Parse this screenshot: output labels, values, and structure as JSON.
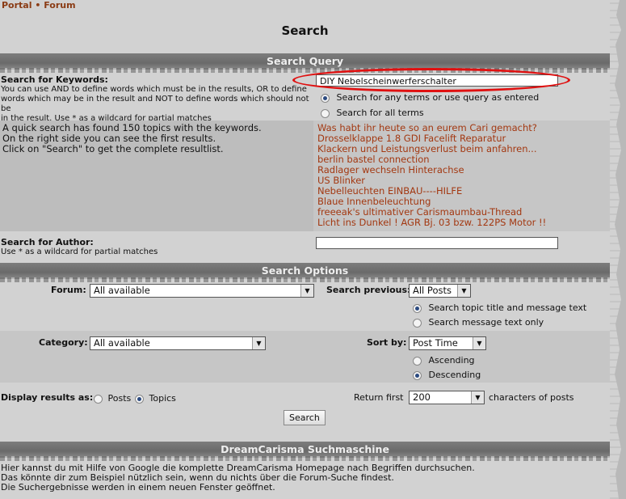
{
  "breadcrumb": {
    "portal": "Portal",
    "sep": "•",
    "forum": "Forum"
  },
  "page_title": "Search",
  "bars": {
    "query": "Search Query",
    "options": "Search Options",
    "engine": "DreamCarisma Suchmaschine"
  },
  "keywords": {
    "label": "Search for Keywords:",
    "help_line1": "You can use AND to define words which must be in the results, OR to define",
    "help_line2": "words which may be in the result and NOT to define words which should not be",
    "help_line3": "in the result. Use * as a wildcard for partial matches",
    "value": "DIY Nebelscheinwerferschalter",
    "opt_any": "Search for any terms or use query as entered",
    "opt_all": "Search for all terms"
  },
  "quick": {
    "line1": "A quick search has found 150 topics with the keywords.",
    "line2": "On the right side you can see the first results.",
    "line3": "Click on \"Search\" to get the complete resultlist."
  },
  "results": [
    "Was habt ihr heute so an eurem Cari gemacht?",
    "Drosselklappe 1.8 GDI Facelift Reparatur",
    "Klackern und Leistungsverlust beim anfahren...",
    "berlin bastel connection",
    "Radlager wechseln Hinterachse",
    "US Blinker",
    "Nebelleuchten EINBAU----HILFE",
    "Blaue Innenbeleuchtung",
    "freeeak's ultimativer Carismaumbau-Thread",
    "Licht ins Dunkel ! AGR Bj. 03 bzw. 122PS Motor !!"
  ],
  "author": {
    "label": "Search for Author:",
    "help": "Use * as a wildcard for partial matches",
    "value": ""
  },
  "options": {
    "forum_label": "Forum:",
    "forum_value": "All available",
    "previous_label": "Search previous:",
    "previous_value": "All Posts",
    "opt_title_text": "Search topic title and message text",
    "opt_message_only": "Search message text only",
    "category_label": "Category:",
    "category_value": "All available",
    "sort_label": "Sort by:",
    "sort_value": "Post Time",
    "asc": "Ascending",
    "desc": "Descending",
    "display_label": "Display results as:",
    "posts": "Posts",
    "topics": "Topics",
    "return_label": "Return first",
    "return_value": "200",
    "return_suffix": "characters of posts",
    "search_button": "Search"
  },
  "engine": {
    "line1": "Hier kannst du mit Hilfe von Google die komplette DreamCarisma Homepage nach Begriffen durchsuchen.",
    "line2": "Das könnte dir zum Beispiel nützlich sein, wenn du nichts über die Forum-Suche findest.",
    "line3": "Die Suchergebnisse werden in einem neuen Fenster geöffnet."
  },
  "colors": {
    "link": "#a33811",
    "highlight": "#e01010",
    "bar": "#6e6e6e"
  }
}
